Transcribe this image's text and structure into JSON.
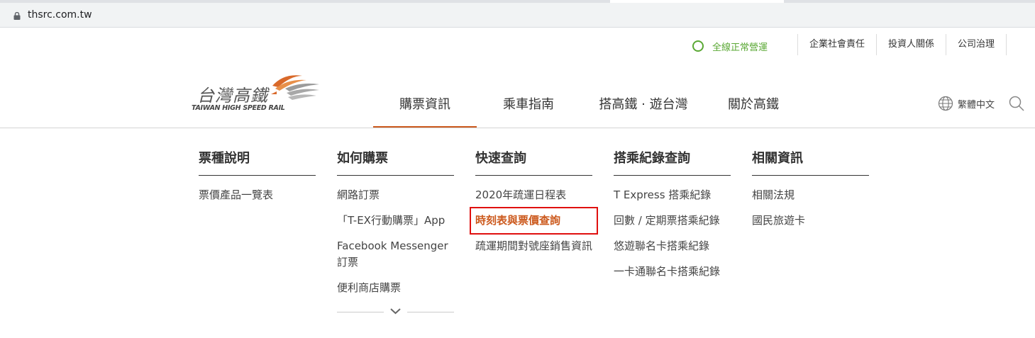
{
  "browser": {
    "url": "thsrc.com.tw"
  },
  "utility": {
    "status": "全線正常營運",
    "links": [
      "企業社會責任",
      "投資人關係",
      "公司治理"
    ]
  },
  "logo": {
    "cn": "台灣高鐵",
    "en": "TAIWAN HIGH SPEED RAIL"
  },
  "nav": {
    "items": [
      "購票資訊",
      "乘車指南",
      "搭高鐵 · 遊台灣",
      "關於高鐵"
    ],
    "language": "繁體中文"
  },
  "menu": {
    "columns": [
      {
        "title": "票種說明",
        "items": [
          "票價產品一覽表"
        ]
      },
      {
        "title": "如何購票",
        "items": [
          "網路訂票",
          "「T-EX行動購票」App",
          "Facebook Messenger 訂票",
          "便利商店購票"
        ]
      },
      {
        "title": "快速查詢",
        "items": [
          "2020年疏運日程表",
          "時刻表與票價查詢",
          "疏運期間對號座銷售資訊"
        ]
      },
      {
        "title": "搭乘紀錄查詢",
        "items": [
          "T Express 搭乘紀錄",
          "回數 / 定期票搭乘紀錄",
          "悠遊聯名卡搭乘紀錄",
          "一卡通聯名卡搭乘紀錄"
        ]
      },
      {
        "title": "相關資訊",
        "items": [
          "相關法規",
          "國民旅遊卡"
        ]
      }
    ]
  },
  "colors": {
    "accent": "#cc5a1e",
    "status": "#5aa834",
    "highlight_box": "#e0100f"
  }
}
